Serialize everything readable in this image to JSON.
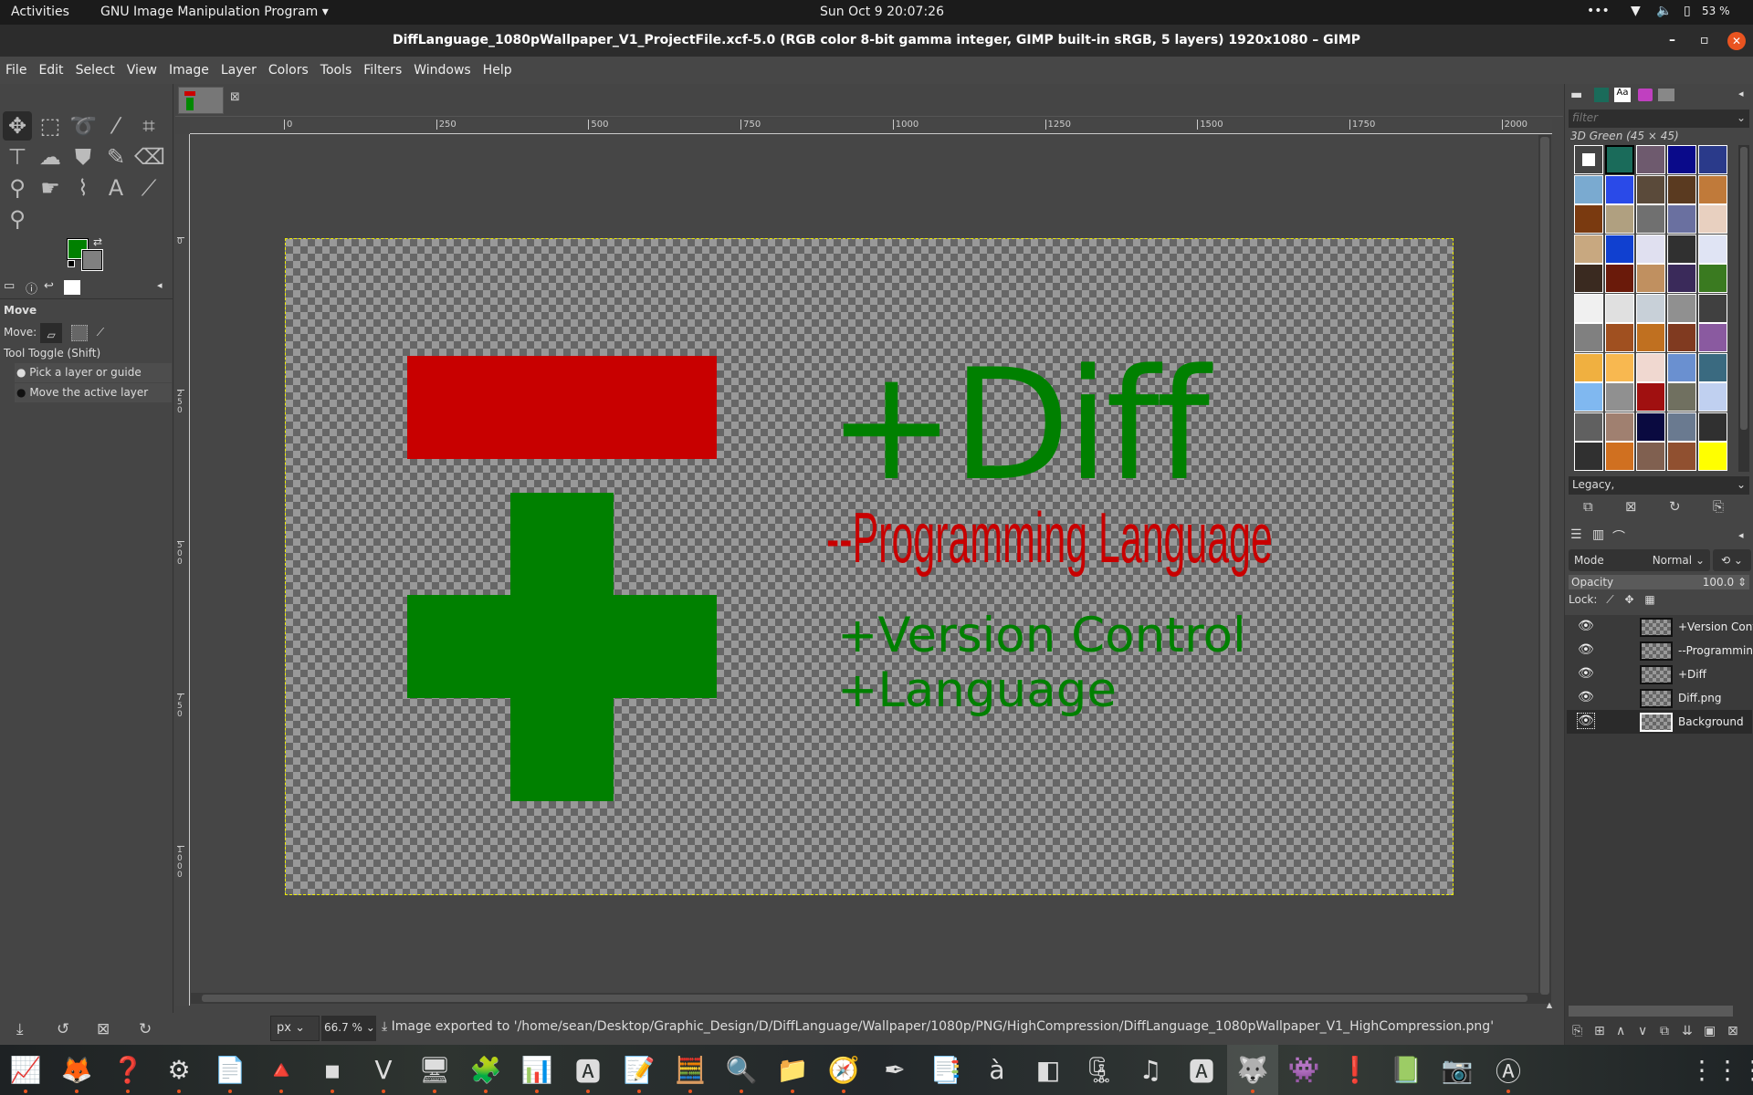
{
  "topbar": {
    "activities": "Activities",
    "app": "GNU Image Manipulation Program ▾",
    "clock": "Sun Oct 9  20:07:26",
    "battery": "53 %"
  },
  "window": {
    "title": "DiffLanguage_1080pWallpaper_V1_ProjectFile.xcf-5.0 (RGB color 8-bit gamma integer, GIMP built-in sRGB, 5 layers) 1920x1080 – GIMP"
  },
  "menu": [
    "File",
    "Edit",
    "Select",
    "View",
    "Image",
    "Layer",
    "Colors",
    "Tools",
    "Filters",
    "Windows",
    "Help"
  ],
  "toolbox": {
    "tools": [
      {
        "name": "move-tool",
        "glyph": "✥"
      },
      {
        "name": "rect-select-tool",
        "glyph": "⬚"
      },
      {
        "name": "free-select-tool",
        "glyph": "➰"
      },
      {
        "name": "fuzzy-select-tool",
        "glyph": "⁄"
      },
      {
        "name": "crop-tool",
        "glyph": "⌗"
      },
      {
        "name": "unified-transform-tool",
        "glyph": "⊤"
      },
      {
        "name": "warp-transform-tool",
        "glyph": "☁"
      },
      {
        "name": "bucket-fill-tool",
        "glyph": "⛊"
      },
      {
        "name": "pencil-tool",
        "glyph": "✎"
      },
      {
        "name": "eraser-tool",
        "glyph": "⌫"
      },
      {
        "name": "clone-tool",
        "glyph": "⚲"
      },
      {
        "name": "smudge-tool",
        "glyph": "☛"
      },
      {
        "name": "paths-tool",
        "glyph": "⌇"
      },
      {
        "name": "text-tool",
        "glyph": "A"
      },
      {
        "name": "color-picker-tool",
        "glyph": "⟋"
      },
      {
        "name": "zoom-tool",
        "glyph": "⚲"
      }
    ],
    "fg_color": "#008000",
    "bg_color": "#808080",
    "options": {
      "title": "Move",
      "move_label": "Move:",
      "toggle_label": "Tool Toggle  (Shift)",
      "opt1": "Pick a layer or guide",
      "opt2": "Move the active layer"
    }
  },
  "ruler": {
    "h_ticks": [
      "0",
      "250",
      "500",
      "750",
      "1000",
      "1250",
      "1500",
      "1750",
      "2000"
    ],
    "v_ticks": [
      "0",
      "250",
      "500",
      "750",
      "1000"
    ]
  },
  "canvas": {
    "minus_color": "#c80000",
    "plus_color": "#008000",
    "title": "+Diff",
    "subtitle": "--Programming Language",
    "line1": "+Version Control",
    "line2": "+Language"
  },
  "status": {
    "unit": "px",
    "zoom": "66.7 %",
    "message": "Image exported to '/home/sean/Desktop/Graphic_Design/D/DiffLanguage/Wallpaper/1080p/PNG/HighCompression/DiffLanguage_1080pWallpaper_V1_HighCompression.png'"
  },
  "patterns": {
    "filter_placeholder": "filter",
    "selected": "3D Green (45 × 45)",
    "tag": "Legacy,",
    "swatches": [
      "#ffffff",
      "#1a6b5a",
      "#6e5a6e",
      "#0a0a8a",
      "#2a3a8a",
      "#7aaad0",
      "#2a4ae8",
      "#5a4a3a",
      "#5a3a20",
      "#c07a3a",
      "#7a3a10",
      "#b0a080",
      "#707070",
      "#6a70a0",
      "#e8d0c0",
      "#c8a880",
      "#1040d0",
      "#e0e0f0",
      "#303030",
      "#e0e4f4",
      "#3a2a20",
      "#6a1a0a",
      "#c09060",
      "#3a2a5a",
      "#3a7a20",
      "#f0f0f0",
      "#e0e0e0",
      "#c8d0d8",
      "#909090",
      "#404040",
      "#808080",
      "#a05020",
      "#c07020",
      "#803a20",
      "#8a5aa0",
      "#f0b040",
      "#f8b850",
      "#f0d8d0",
      "#6a90d0",
      "#3a6a80",
      "#80b8f0",
      "#909090",
      "#a01010",
      "#707060",
      "#c0d0f0",
      "#606060",
      "#a08070",
      "#0a0a40",
      "#6a7a90",
      "#303030",
      "#303030",
      "#d07020",
      "#806050",
      "#905030",
      "#ffff00"
    ]
  },
  "layers": {
    "mode_label": "Mode",
    "mode": "Normal",
    "opacity_label": "Opacity",
    "opacity": "100.0",
    "lock_label": "Lock:",
    "items": [
      {
        "name": "+Version Control"
      },
      {
        "name": "--Programming Language"
      },
      {
        "name": "+Diff"
      },
      {
        "name": "Diff.png"
      },
      {
        "name": "Background"
      }
    ]
  },
  "dock": [
    "system-monitor",
    "firefox",
    "help",
    "settings",
    "writer",
    "vlc",
    "terminal",
    "vim",
    "remote-desktop",
    "extensions",
    "sysprof",
    "software",
    "text-editor",
    "calculator",
    "image-viewer",
    "files",
    "compass",
    "inkscape",
    "document-viewer",
    "character-map",
    "virtualbox",
    "archive",
    "music",
    "font-viewer",
    "gimp",
    "mario",
    "error-report",
    "calc",
    "screenshot",
    "updater",
    "app-grid"
  ]
}
